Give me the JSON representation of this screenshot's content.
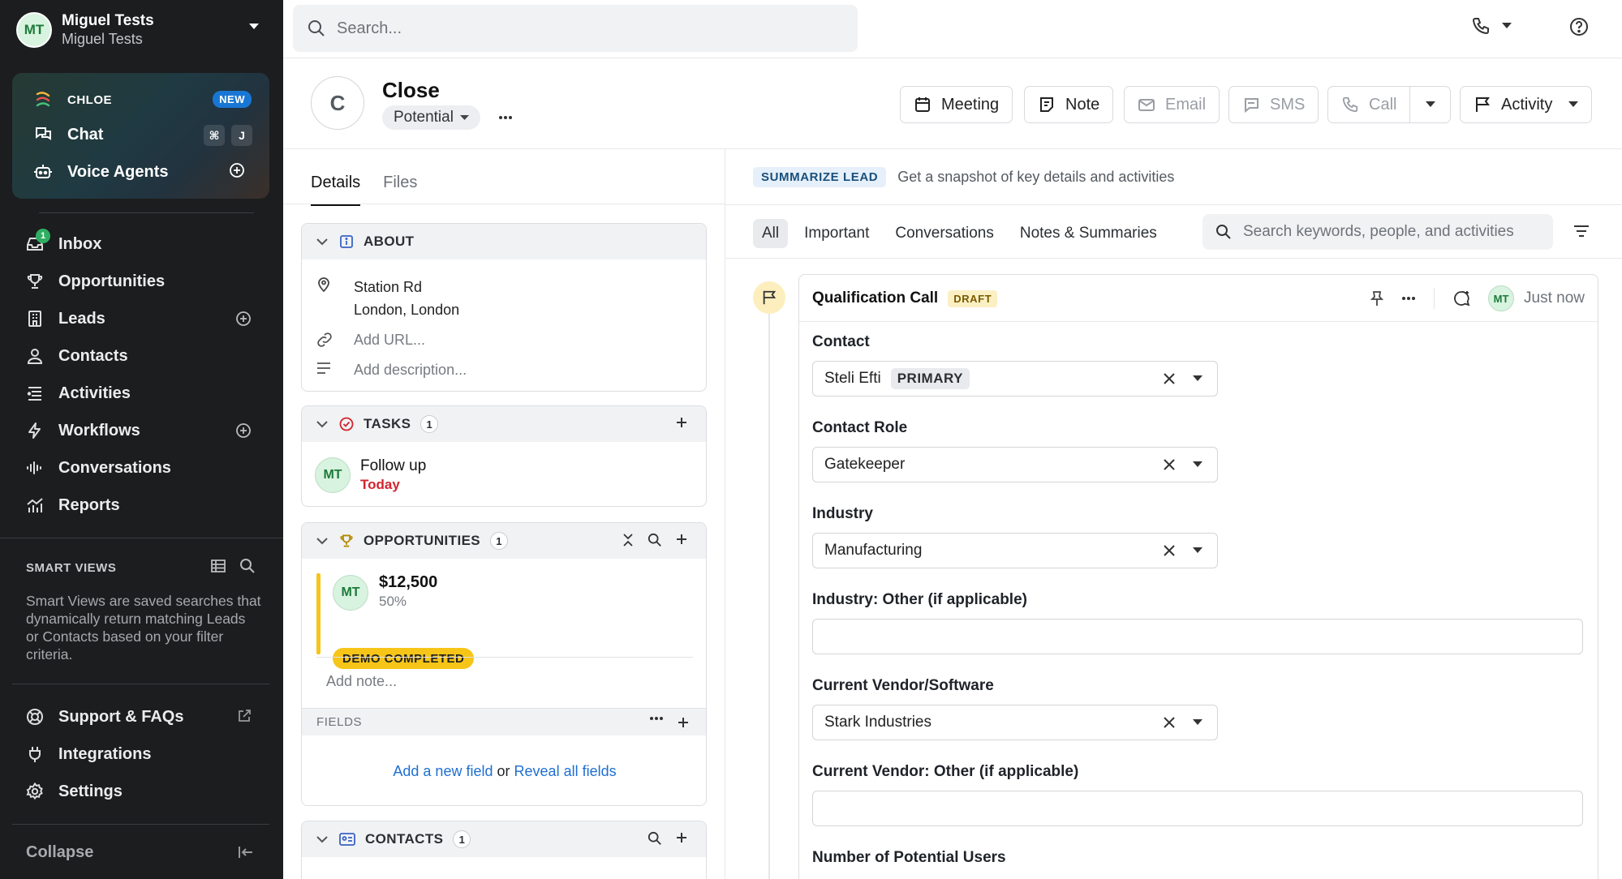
{
  "user": {
    "initials": "MT",
    "name": "Miguel Tests",
    "org": "Miguel Tests"
  },
  "ai": {
    "chloe": "CHLOE",
    "new_badge": "NEW",
    "chat": "Chat",
    "kbd_cmd": "⌘",
    "kbd_j": "J",
    "voice": "Voice Agents"
  },
  "nav": {
    "inbox": "Inbox",
    "inbox_count": "1",
    "opportunities": "Opportunities",
    "leads": "Leads",
    "contacts": "Contacts",
    "activities": "Activities",
    "workflows": "Workflows",
    "conversations": "Conversations",
    "reports": "Reports"
  },
  "smart_views": {
    "title": "SMART VIEWS",
    "description": "Smart Views are saved searches that dynamically return matching Leads or Contacts based on your filter criteria."
  },
  "footer": {
    "support": "Support & FAQs",
    "integrations": "Integrations",
    "settings": "Settings",
    "collapse": "Collapse"
  },
  "search": {
    "placeholder": "Search..."
  },
  "lead": {
    "initial": "C",
    "name": "Close",
    "status": "Potential"
  },
  "actions": {
    "meeting": "Meeting",
    "note": "Note",
    "email": "Email",
    "sms": "SMS",
    "call": "Call",
    "activity": "Activity"
  },
  "details": {
    "tabs": [
      "Details",
      "Files"
    ],
    "about": {
      "title": "ABOUT",
      "address_line1": "Station Rd",
      "address_line2": "London, London",
      "url_placeholder": "Add URL...",
      "description_placeholder": "Add description..."
    },
    "tasks": {
      "title": "TASKS",
      "count": "1",
      "avatar": "MT",
      "item_title": "Follow up",
      "item_due": "Today"
    },
    "opportunities": {
      "title": "OPPORTUNITIES",
      "count": "1",
      "avatar": "MT",
      "value": "$12,500",
      "probability": "50%",
      "stage": "DEMO COMPLETED",
      "note_placeholder": "Add note..."
    },
    "fields": {
      "title": "FIELDS",
      "add_link": "Add a new field",
      "or": "or",
      "reveal_link": "Reveal all fields"
    },
    "contacts": {
      "title": "CONTACTS",
      "count": "1"
    }
  },
  "activity_panel": {
    "summarize_badge": "SUMMARIZE LEAD",
    "summarize_text": "Get a snapshot of key details and activities",
    "filters": [
      "All",
      "Important",
      "Conversations",
      "Notes & Summaries"
    ],
    "search_placeholder": "Search keywords, people, and activities",
    "card": {
      "title": "Qualification Call",
      "badge": "DRAFT",
      "avatar": "MT",
      "time": "Just now",
      "fields": {
        "contact_label": "Contact",
        "contact_value": "Steli Efti",
        "contact_badge": "PRIMARY",
        "role_label": "Contact Role",
        "role_value": "Gatekeeper",
        "industry_label": "Industry",
        "industry_value": "Manufacturing",
        "industry_other_label": "Industry: Other (if applicable)",
        "vendor_label": "Current Vendor/Software",
        "vendor_value": "Stark Industries",
        "vendor_other_label": "Current Vendor: Other (if applicable)",
        "users_label": "Number of Potential Users"
      }
    }
  }
}
